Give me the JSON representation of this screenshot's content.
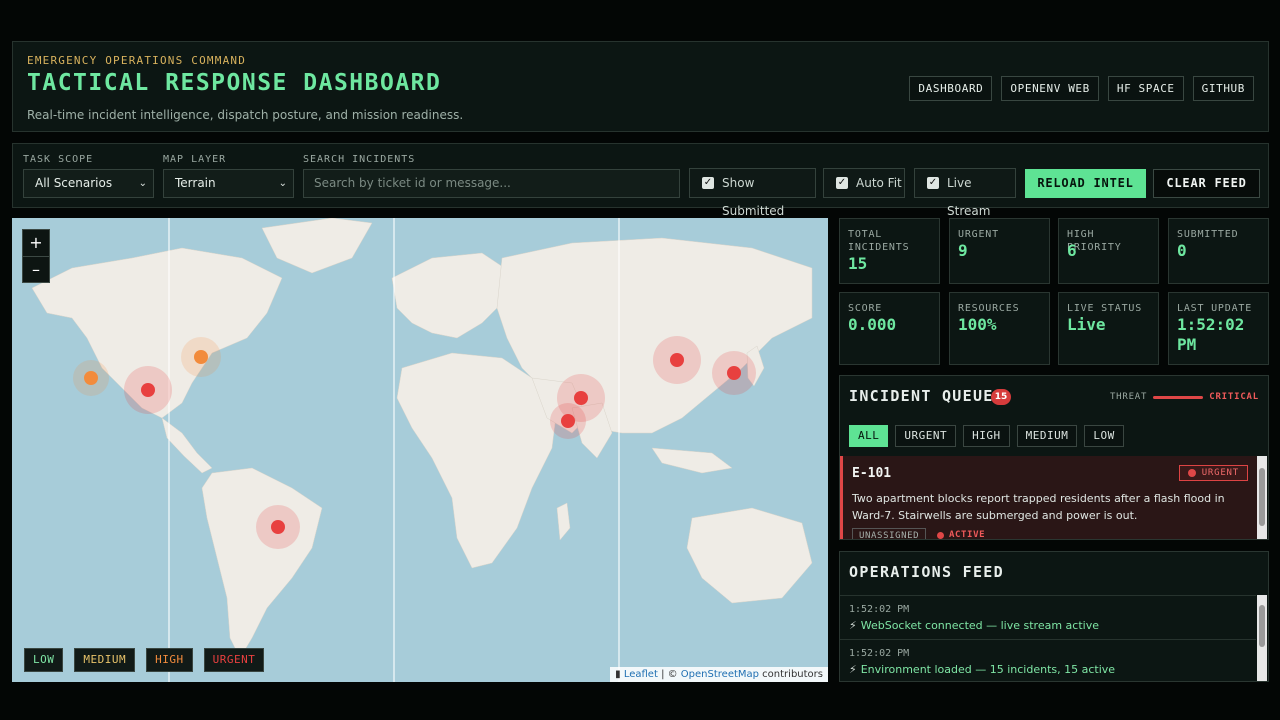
{
  "header": {
    "eyebrow": "EMERGENCY OPERATIONS COMMAND",
    "title": "TACTICAL RESPONSE DASHBOARD",
    "subtitle": "Real-time incident intelligence, dispatch posture, and mission readiness.",
    "nav": [
      "DASHBOARD",
      "OPENENV WEB",
      "HF SPACE",
      "GITHUB"
    ]
  },
  "toolbar": {
    "task_scope_label": "TASK SCOPE",
    "task_scope_value": "All Scenarios",
    "map_layer_label": "MAP LAYER",
    "map_layer_value": "Terrain",
    "search_label": "SEARCH INCIDENTS",
    "search_placeholder": "Search by ticket id or message...",
    "show_submitted": "Show Submitted",
    "auto_fit": "Auto Fit",
    "live_stream": "Live Stream",
    "reload": "RELOAD INTEL",
    "clear": "CLEAR FEED"
  },
  "map": {
    "zoom_in": "+",
    "zoom_out": "–",
    "legend": {
      "low": "LOW",
      "medium": "MEDIUM",
      "high": "HIGH",
      "urgent": "URGENT"
    },
    "attribution_leaflet": "Leaflet",
    "attribution_sep": " | © ",
    "attribution_osm": "OpenStreetMap",
    "attribution_tail": " contributors",
    "colors": {
      "water": "#a7ccd9",
      "land": "#efece6",
      "urgent": "#e8403f",
      "high": "#f28b3c"
    }
  },
  "stats": {
    "total_label": "TOTAL INCIDENTS",
    "total": "15",
    "urgent_label": "URGENT",
    "urgent": "9",
    "high_label": "HIGH PRIORITY",
    "high": "6",
    "submitted_label": "SUBMITTED",
    "submitted": "0",
    "score_label": "SCORE",
    "score": "0.000",
    "resources_label": "RESOURCES",
    "resources": "100%",
    "live_label": "LIVE STATUS",
    "live": "Live",
    "update_label": "LAST UPDATE",
    "update": "1:52:02 PM"
  },
  "queue": {
    "title": "INCIDENT QUEUE",
    "count": "15",
    "threat_label": "THREAT",
    "threat_value": "CRITICAL",
    "filters": [
      "ALL",
      "URGENT",
      "HIGH",
      "MEDIUM",
      "LOW"
    ],
    "card": {
      "id": "E-101",
      "tag": "URGENT",
      "message": "Two apartment blocks report trapped residents after a flash flood in Ward-7. Stairwells are submerged and power is out.",
      "assignee": "UNASSIGNED",
      "status": "ACTIVE"
    }
  },
  "feed": {
    "title": "OPERATIONS FEED",
    "entries": [
      {
        "time": "1:52:02 PM",
        "message": "WebSocket connected — live stream active"
      },
      {
        "time": "1:52:02 PM",
        "message": "Environment loaded — 15 incidents, 15 active"
      }
    ]
  }
}
